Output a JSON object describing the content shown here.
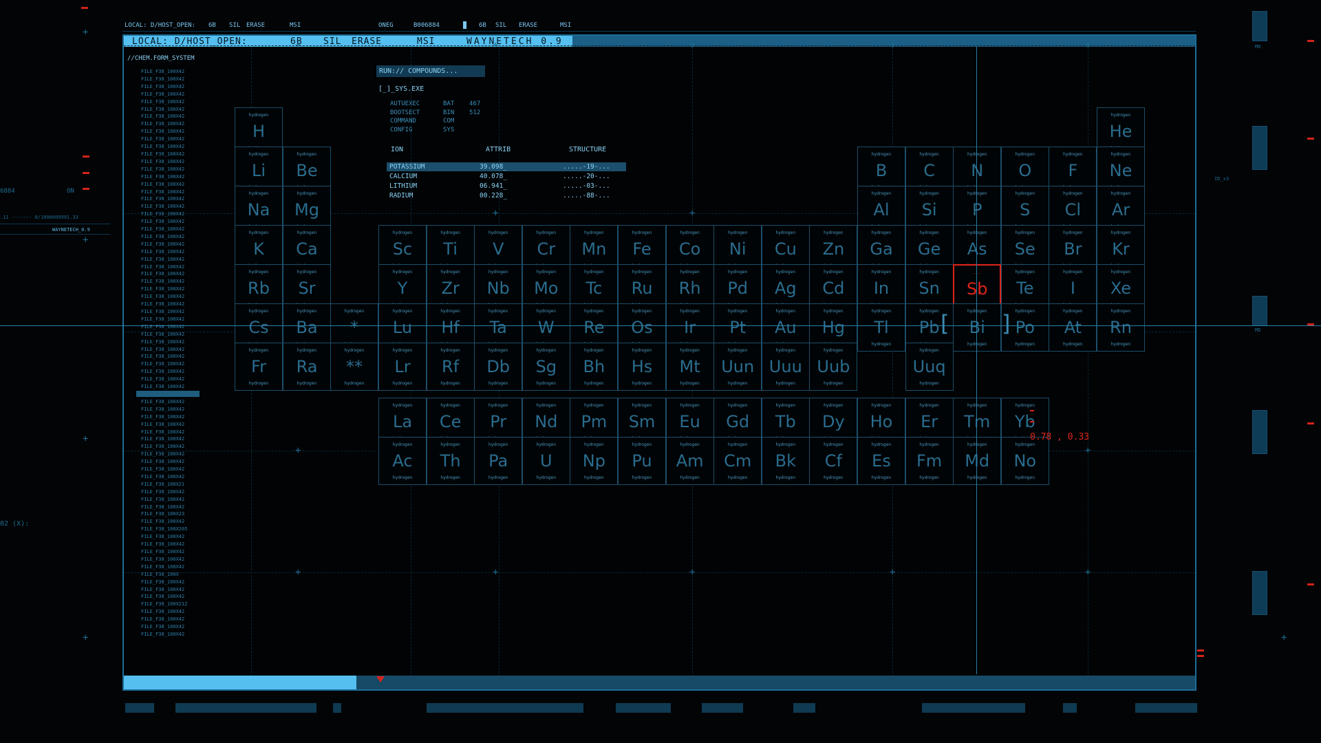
{
  "top_status": {
    "path": "LOCAL: D/HOST_OPEN:",
    "f1": "6B",
    "f2": "SIL",
    "f3": "ERASE",
    "f4": "MSI",
    "oneg": "ONEG",
    "code": "B006884",
    "f5": "6B",
    "f6": "SIL",
    "f7": "ERASE",
    "f8": "MSI"
  },
  "title_bar": {
    "path": "LOCAL: D/HOST_OPEN:",
    "f1": "6B",
    "f2": "SIL",
    "f3": "ERASE",
    "f4": "MSI",
    "app": "WAYNETECH_0.9"
  },
  "side_left": {
    "code": "6884",
    "on": "ON",
    "line": ".11 ------- 0/1090009991.33",
    "app": "WAYNETECH_0.9",
    "axis": "02 (X):"
  },
  "side_right": {
    "md1": "MD",
    "md2": "MD",
    "label": "ID_x3"
  },
  "chem_system": "//CHEM.FORM_SYSTEM",
  "file_list": [
    "FILE_F38_100X42",
    "FILE_F38_100X42",
    "FILE_F38_100X42",
    "FILE_F38_100X42",
    "FILE_F38_100X42",
    "FILE_F38_100X42",
    "FILE_F38_100X42",
    "FILE_F38_100X42",
    "FILE_F38_100X42",
    "FILE_F38_100X42",
    "FILE_F38_100X42",
    "FILE_F38_100X42",
    "FILE_F38_100X42",
    "FILE_F38_100X42",
    "FILE_F38_100X42",
    "FILE_F38_100X42",
    "FILE_F38_100X42",
    "FILE_F38_100X42",
    "FILE_F38_100X42",
    "FILE_F38_100X42",
    "FILE_F38_100X42",
    "FILE_F38_100X42",
    "FILE_F38_100X42",
    "FILE_F38_100X42",
    "FILE_F38_100X42",
    "FILE_F38_100X42",
    "FILE_F38_100X42",
    "FILE_F38_100X42",
    "FILE_F38_100X42",
    "FILE_F38_100X42",
    "FILE_F38_100X42",
    "FILE_F38_100X42",
    "FILE_F38_100X42",
    "FILE_F38_100X42",
    "FILE_F38_100X42",
    "FILE_F38_100X42",
    "FILE_F38_100X42",
    "FILE_F38_100X42",
    "FILE_F38_100X42",
    "FILE_F38_100X42",
    "FILE_F38_100X42",
    "FILE_F38_100X42",
    "FILE_F38_100X42",
    "FILE_F38_100X42",
    "FILE_F38_100X42",
    "FILE_F38_100X42",
    "FILE_F38_100X42",
    "FILE_F38_100X42",
    "FILE_F38_100X42",
    "FILE_F38_100X42",
    "FILE_F38_100X42",
    "FILE_F38_100X42",
    "FILE_F38_100X42",
    "FILE_F38_100X42",
    "FILE_F38_100X42",
    "FILE_F38_100X21",
    "FILE_F38_100X42",
    "FILE_F38_100X42",
    "FILE_F38_100X42",
    "FILE_F38_100X23",
    "FILE_F38_100X42",
    "FILE_F38_100X205",
    "FILE_F38_100X42",
    "FILE_F38_100X42",
    "FILE_F38_100X42",
    "FILE_F38_100X42",
    "FILE_F38_100X42",
    "FILE_F38_100X",
    "FILE_F38_100X42",
    "FILE_F38_100X42",
    "FILE_F38_100X42",
    "FILE_F38_100X212",
    "FILE_F38_100X42",
    "FILE_F38_100X42",
    "FILE_F38_100X42",
    "FILE_F38_100X42"
  ],
  "run_label": "RUN:// COMPOUNDS...",
  "sys_exe": "[_]_SYS.EXE",
  "boot_files": [
    {
      "name": "AUTUEXEC",
      "ext": "BAT",
      "size": "467"
    },
    {
      "name": "BOOTSECT",
      "ext": "BIN",
      "size": "512"
    },
    {
      "name": "COMMAND",
      "ext": "COM",
      "size": ""
    },
    {
      "name": "CONFIG",
      "ext": "SYS",
      "size": ""
    }
  ],
  "ion_table": {
    "headers": [
      "ION",
      "ATTRIB",
      "STRUCTURE"
    ],
    "rows": [
      {
        "ion": "POTASSIUM",
        "attrib": "39.098_",
        "structure": ".....-19-..."
      },
      {
        "ion": "CALCIUM",
        "attrib": "40.078_",
        "structure": ".....-20-..."
      },
      {
        "ion": "LITHIUM",
        "attrib": "06.941_",
        "structure": ".....-03-..."
      },
      {
        "ion": "RADIUM",
        "attrib": "00.228_",
        "structure": ".....-88-..."
      }
    ]
  },
  "cell_label": "hydrogen",
  "highlight_label": "......",
  "elements_grid": [
    [
      "H",
      "",
      "",
      "",
      "",
      "",
      "",
      "",
      "",
      "",
      "",
      "",
      "",
      "",
      "",
      "",
      "",
      "He"
    ],
    [
      "Li",
      "Be",
      "",
      "",
      "",
      "",
      "",
      "",
      "",
      "",
      "",
      "",
      "B",
      "C",
      "N",
      "O",
      "F",
      "Ne"
    ],
    [
      "Na",
      "Mg",
      "",
      "",
      "",
      "",
      "",
      "",
      "",
      "",
      "",
      "",
      "Al",
      "Si",
      "P",
      "S",
      "Cl",
      "Ar"
    ],
    [
      "K",
      "Ca",
      "",
      "Sc",
      "Ti",
      "V",
      "Cr",
      "Mn",
      "Fe",
      "Co",
      "Ni",
      "Cu",
      "Zn",
      "Ga",
      "Ge",
      "As",
      "Se",
      "Br",
      "Kr"
    ],
    [
      "Rb",
      "Sr",
      "",
      "Y",
      "Zr",
      "Nb",
      "Mo",
      "Tc",
      "Ru",
      "Rh",
      "Pd",
      "Ag",
      "Cd",
      "In",
      "Sn",
      "Sb",
      "Te",
      "I",
      "Xe"
    ],
    [
      "Cs",
      "Ba",
      "*",
      "Lu",
      "Hf",
      "Ta",
      "W",
      "Re",
      "Os",
      "Ir",
      "Pt",
      "Au",
      "Hg",
      "Tl",
      "Pb",
      "Bi",
      "Po",
      "At",
      "Rn"
    ],
    [
      "Fr",
      "Ra",
      "**",
      "Lr",
      "Rf",
      "Db",
      "Sg",
      "Bh",
      "Hs",
      "Mt",
      "Uun",
      "Uuu",
      "Uub",
      "",
      "Uuq",
      "",
      "",
      "",
      ""
    ]
  ],
  "lanthanides": [
    "La",
    "Ce",
    "Pr",
    "Nd",
    "Pm",
    "Sm",
    "Eu",
    "Gd",
    "Tb",
    "Dy",
    "Ho",
    "Er",
    "Tm",
    "Yb"
  ],
  "actinides": [
    "Ac",
    "Th",
    "Pa",
    "U",
    "Np",
    "Pu",
    "Am",
    "Cm",
    "Bk",
    "Cf",
    "Es",
    "Fm",
    "Md",
    "No"
  ],
  "highlighted_element": "Sb",
  "cursor_coords": "0.78 , 0.33",
  "colors": {
    "accent": "#55bff0",
    "highlight": "#e0241a",
    "cell_border": "#1b4e6a"
  }
}
